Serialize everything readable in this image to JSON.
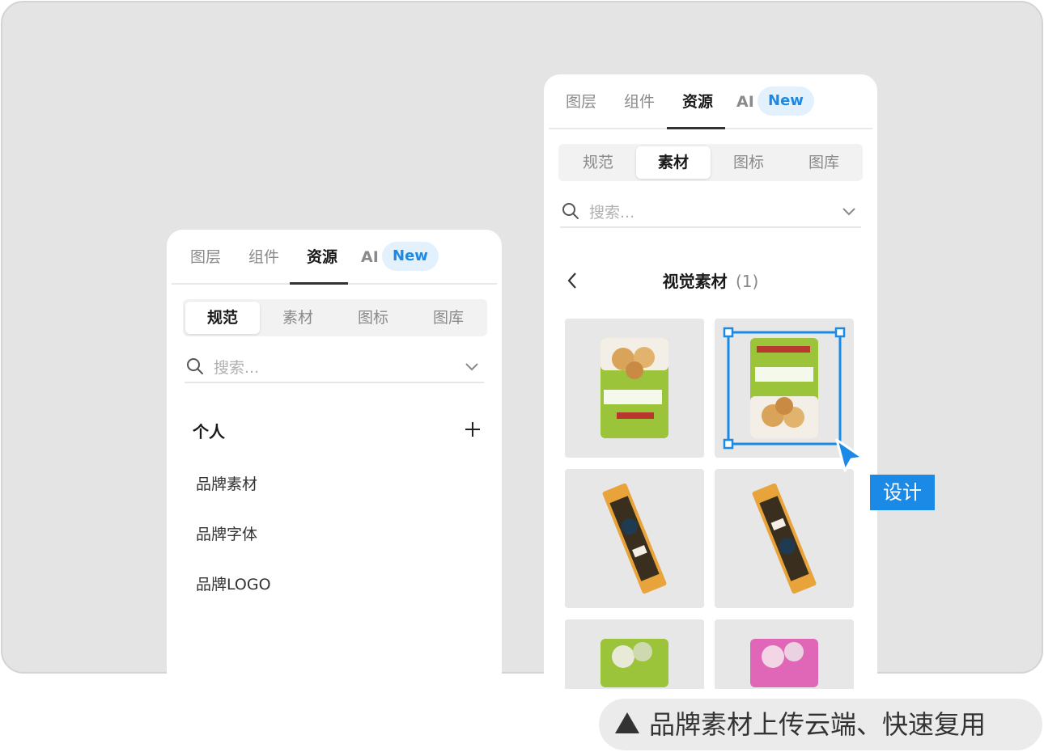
{
  "left_panel": {
    "tabs": [
      "图层",
      "组件",
      "资源"
    ],
    "ai_tab": "AI",
    "new_badge": "New",
    "segments": [
      "规范",
      "素材",
      "图标",
      "图库"
    ],
    "search_placeholder": "搜索...",
    "section_title": "个人",
    "items": [
      "品牌素材",
      "品牌字体",
      "品牌LOGO"
    ]
  },
  "right_panel": {
    "tabs": [
      "图层",
      "组件",
      "资源"
    ],
    "ai_tab": "AI",
    "new_badge": "New",
    "segments": [
      "规范",
      "素材",
      "图标",
      "图库"
    ],
    "search_placeholder": "搜索...",
    "folder_title": "视觉素材",
    "folder_count": "(1)"
  },
  "cursor_tag": "设计",
  "caption": "品牌素材上传云端、快速复用",
  "colors": {
    "accent": "#1a8ae6",
    "badge_bg": "#e3f1fc"
  }
}
